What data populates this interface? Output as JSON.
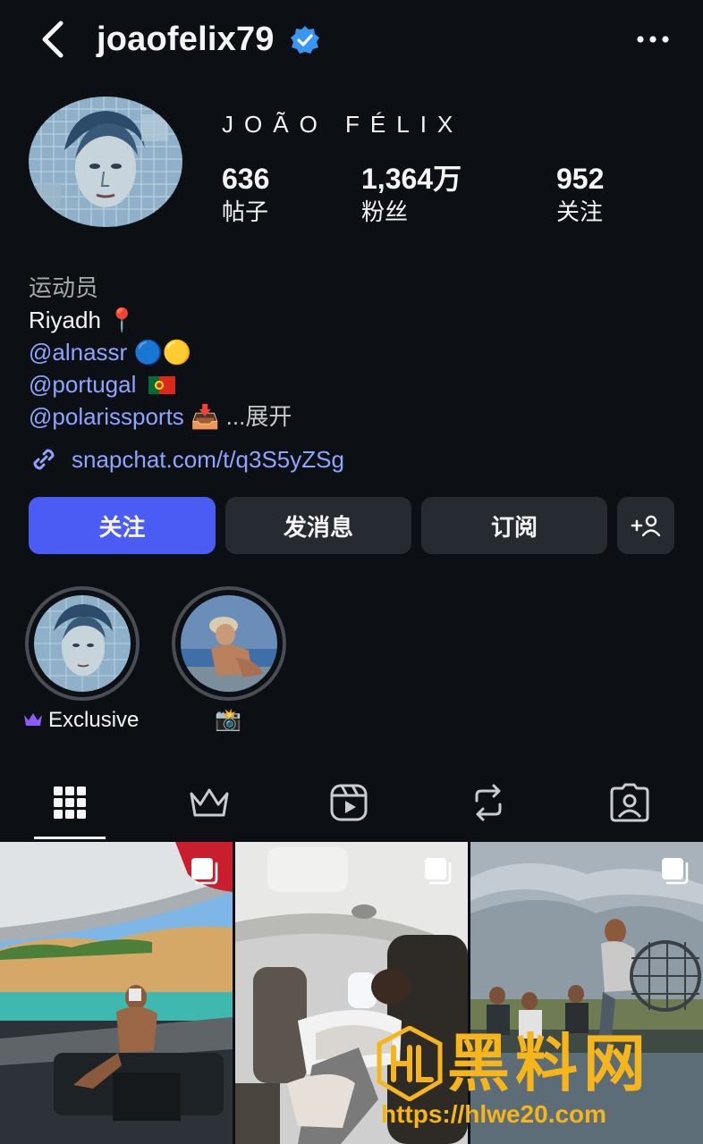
{
  "header": {
    "username": "joaofelix79",
    "back_icon": "chevron-left-icon",
    "verified_icon": "verified-badge-icon",
    "more_icon": "more-horizontal-icon"
  },
  "profile": {
    "display_name": "JOÃO FÉLIX",
    "stats": [
      {
        "value": "636",
        "label": "帖子"
      },
      {
        "value": "1,364万",
        "label": "粉丝"
      },
      {
        "value": "952",
        "label": "关注"
      }
    ]
  },
  "bio": {
    "category": "运动员",
    "location": "Riyadh 📍",
    "mentions": [
      {
        "handle": "@alnassr",
        "suffix": "🔵🟡"
      },
      {
        "handle": "@portugal",
        "suffix": ""
      },
      {
        "handle": "@polarissports",
        "suffix": "📥"
      }
    ],
    "expand_ellipsis": "...",
    "expand_label": "展开",
    "external_link": "snapchat.com/t/q3S5yZSg"
  },
  "actions": {
    "follow": "关注",
    "message": "发消息",
    "subscribe": "订阅",
    "suggest_icon": "add-person-icon",
    "suggest_label": "+"
  },
  "highlights": [
    {
      "label": "Exclusive",
      "icon": "crown-icon"
    },
    {
      "label": "📸",
      "icon": ""
    }
  ],
  "tabs": [
    {
      "name": "posts",
      "icon": "grid-icon",
      "active": true
    },
    {
      "name": "exclusive",
      "icon": "crown-icon",
      "active": false
    },
    {
      "name": "reels",
      "icon": "reels-icon",
      "active": false
    },
    {
      "name": "reposts",
      "icon": "repost-icon",
      "active": false
    },
    {
      "name": "tagged",
      "icon": "tagged-person-icon",
      "active": false
    }
  ],
  "grid": [
    {
      "scene": "yacht on turquoise water with sandstone cliffs",
      "multi": true
    },
    {
      "scene": "private jet cabin interior",
      "multi": true
    },
    {
      "scene": "airboat ride under cloudy sky",
      "multi": true
    }
  ],
  "watermark": {
    "text": "黑料网",
    "url": "https://hlwe20.com",
    "logo": "HL"
  },
  "colors": {
    "background": "#0c0f14",
    "primary_button": "#4b5cf5",
    "secondary_button": "#262a31",
    "link": "#8fa4ff",
    "verified": "#3897f0",
    "watermark": "#f6b51b"
  }
}
